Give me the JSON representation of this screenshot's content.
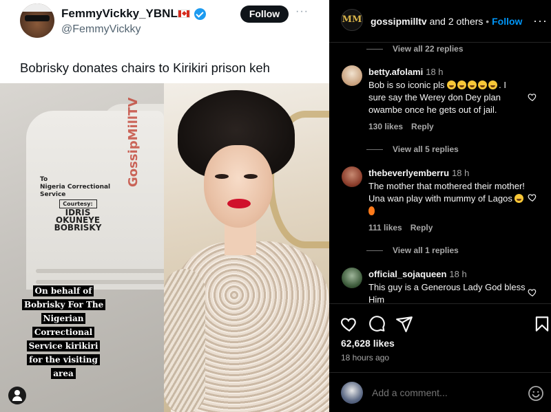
{
  "tweet": {
    "display_name": "FemmyVickky_YBNL",
    "handle": "@FemmyVickky",
    "follow_label": "Follow",
    "more_label": "···",
    "text": "Bobrisky donates chairs to Kirikiri prison keh",
    "photo": {
      "watermark": "GossipMillTV",
      "stamp_line1": "To",
      "stamp_line2": "Nigeria Correctional Service",
      "stamp_courtesy": "Courtesy:",
      "stamp_name1": "IDRIS",
      "stamp_name2": "OKUNEYE",
      "stamp_name3": "BOBRISKY",
      "story_caption": "On behalf of Bobrisky For The Nigerian Correctional Service kirikiri for the visiting area"
    }
  },
  "post": {
    "logo_text": "MM",
    "username": "gossipmilltv",
    "collab_text": " and 2 others",
    "separator": " • ",
    "follow_label": "Follow",
    "more_label": "···",
    "likes": "62,628 likes",
    "time": "18 hours ago",
    "add_comment_placeholder": "Add a comment..."
  },
  "replies_toggles": [
    "View all 22 replies",
    "View all 5 replies",
    "View all 1 replies"
  ],
  "comments": [
    {
      "username": "betty.afolami",
      "time": "18 h",
      "text_a": "Bob is so iconic pls ",
      "text_b": "I sure say the Werey don Dey plan owambe once he gets out of jail.",
      "likes": "130 likes",
      "reply_label": "Reply",
      "avatar_color": "#d9c3a8"
    },
    {
      "username": "thebeverlyemberru",
      "time": "18 h",
      "text_a": "The mother that mothered their mother! Una wan play with mummy of Lagos ",
      "likes": "111 likes",
      "reply_label": "Reply",
      "avatar_color": "#8b3d2b"
    },
    {
      "username": "official_sojaqueen",
      "time": "18 h",
      "text_a": "This guy is a Generous Lady God bless Him",
      "avatar_color": "#3c5a3a"
    }
  ],
  "icons": {
    "heart": "heart-icon",
    "comment": "comment-icon",
    "share": "share-icon",
    "bookmark": "bookmark-icon",
    "emoji": "emoji-icon"
  },
  "colors": {
    "ig_link": "#0095f6",
    "twitter_verified": "#1d9bf0"
  }
}
